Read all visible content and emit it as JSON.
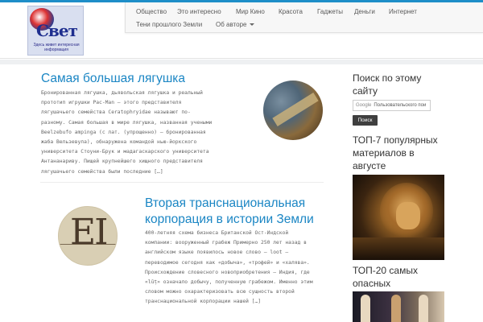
{
  "logo": {
    "big_text": "Свет",
    "tagline": "Здесь живет интересная информация"
  },
  "nav": {
    "items": [
      {
        "label": "Общество"
      },
      {
        "label": "Это интересно"
      },
      {
        "label": "Мир Кино"
      },
      {
        "label": "Красота"
      },
      {
        "label": "Гаджеты"
      },
      {
        "label": "Деньги"
      },
      {
        "label": "Интернет"
      },
      {
        "label": "Тени прошлого Земли"
      },
      {
        "label": "Об авторе"
      }
    ]
  },
  "posts": [
    {
      "title": "Самая большая лягушка",
      "excerpt": [
        "Бронированная лягушка, дьявольская лягушка и реальный",
        "прототип игрушки Pac-Man – этого представителя",
        "лягушачьего семейства Ceratophryidae называют по-",
        "разному. Самая большая в мире лягушка, названная учеными",
        "Beelzebufo ampinga (с лат. (упрощенно) – бронированная",
        "жаба Вельзевула), обнаружена командой нью-йоркского",
        "университета Стоуни-Брук и мадагаскарского университета",
        "Антананариву. Пищей крупнейшего хищного представителя",
        "лягушачьего семейства были последние […]"
      ]
    },
    {
      "title_lines": [
        "Вторая транснациональная",
        "корпорация в истории Земли"
      ],
      "excerpt": [
        "400-летняя схема бизнеса Британской Ост-Индской",
        "компании: вооруженный грабеж Примерно 250 лет назад в",
        "английском языке появилось новое слово – loot –",
        "переводимое сегодня как «добыча», «трофей» и «халява».",
        "Происхождение словесного новоприобретения – Индия, где",
        "«lūṭ» означало добычу, полученную грабежом. Именно этим",
        "словом можно охарактеризовать всю сущность второй",
        "транснациональной корпорации нашей […]"
      ]
    }
  ],
  "sidebar": {
    "search_heading_lines": [
      "Поиск по этому",
      "сайту"
    ],
    "search_prefix": "Google",
    "search_placeholder": "Пользовательского пои",
    "search_button": "Поиск",
    "top7_heading_lines": [
      "ТОП-7 популярных",
      "материалов в",
      "августе"
    ],
    "top20_heading_lines": [
      "ТОП-20 самых",
      "опасных"
    ]
  },
  "colors": {
    "accent": "#1b86c4",
    "topbar": "#1e8ec8",
    "button_bg": "#3f3f3f"
  }
}
